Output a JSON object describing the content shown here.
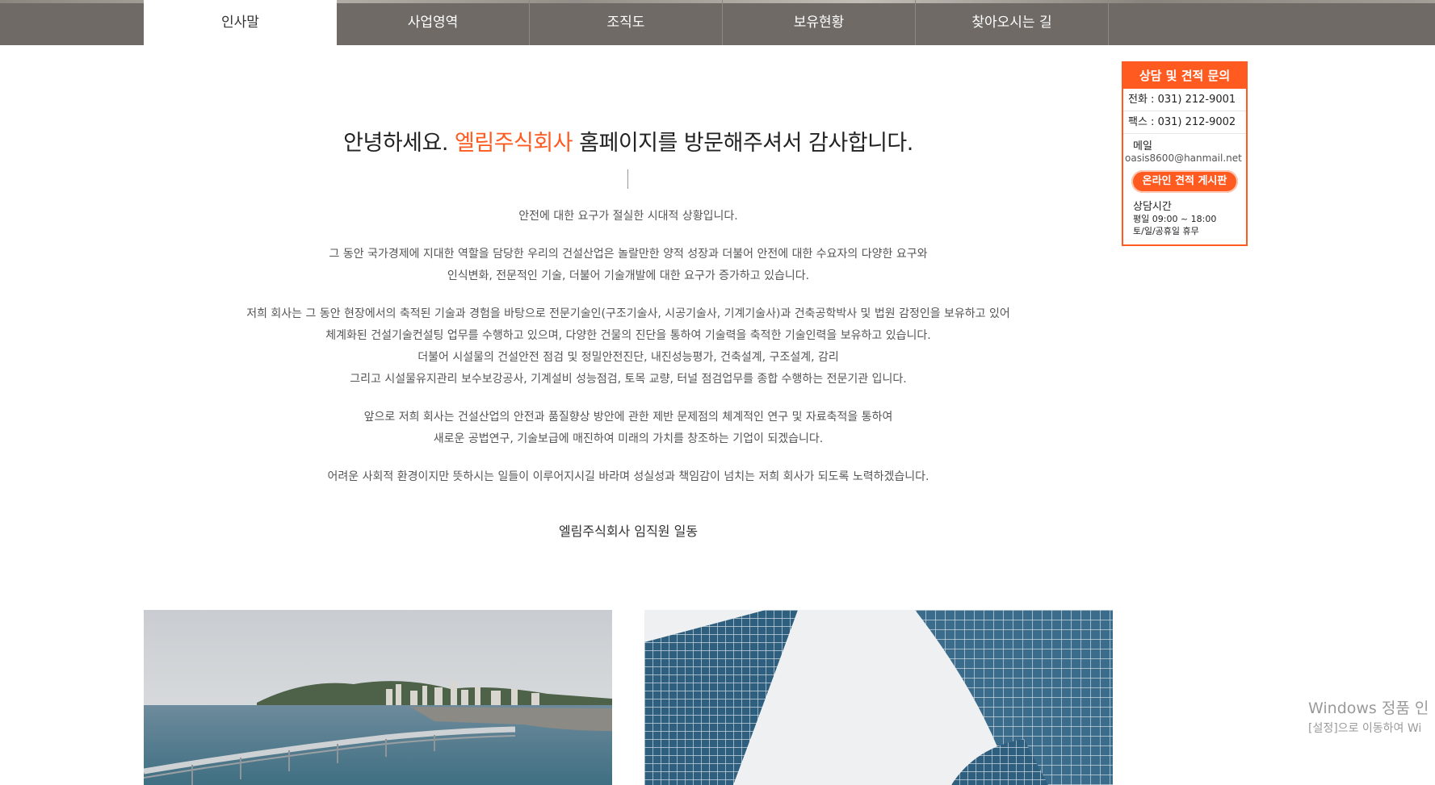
{
  "nav": {
    "tabs": [
      "인사말",
      "사업영역",
      "조직도",
      "보유현황",
      "찾아오시는 길"
    ],
    "active_index": 0
  },
  "greeting": {
    "prefix": "안녕하세요. ",
    "brand": "엘림주식회사",
    "suffix": " 홈페이지를 방문해주셔서 감사합니다."
  },
  "body": {
    "p1": [
      "안전에 대한 요구가 절실한 시대적 상황입니다."
    ],
    "p2": [
      "그 동안 국가경제에 지대한 역할을 담당한 우리의 건설산업은 놀랄만한 양적 성장과 더불어 안전에 대한 수요자의 다양한 요구와",
      "인식변화, 전문적인 기술, 더불어 기술개발에 대한 요구가 증가하고 있습니다."
    ],
    "p3": [
      "저희 회사는 그 동안 현장에서의 축적된 기술과 경험을 바탕으로 전문기술인(구조기술사, 시공기술사, 기계기술사)과 건축공학박사 및 법원 감정인을 보유하고 있어",
      "체계화된 건설기술컨설팅 업무를 수행하고 있으며, 다양한 건물의 진단을 통하여 기술력을 축적한 기술인력을 보유하고 있습니다.",
      "더불어 시설물의 건설안전 점검 및 정밀안전진단, 내진성능평가, 건축설계, 구조설계, 감리",
      "그리고 시설물유지관리 보수보강공사, 기계설비 성능점검, 토목 교량, 터널 점검업무를 종합 수행하는 전문기관 입니다."
    ],
    "p4": [
      "앞으로 저희 회사는 건설산업의 안전과 품질향상 방안에 관한 제반 문제점의 체계적인 연구 및 자료축적을 통하여",
      "새로운 공법연구, 기술보급에 매진하여 미래의 가치를 창조하는 기업이 되겠습니다."
    ],
    "p5": [
      "어려운 사회적 환경이지만 뜻하시는 일들이 이루어지시길 바라며 성실성과 책임감이 넘치는 저희 회사가 되도록 노력하겠습니다."
    ]
  },
  "signature": "엘림주식회사 임직원 일동",
  "consult": {
    "title": "상담 및 견적 문의",
    "phone": "전화 : 031) 212-9001",
    "fax": "팩스 : 031) 212-9002",
    "mail_label": "메일",
    "mail": "oasis8600@hanmail.net",
    "online_button": "온라인 견적 게시판",
    "hours_title": "상담시간",
    "hours_line1": "평일 09:00 ~ 18:00",
    "hours_line2": "토/일/공휴일 휴무"
  },
  "watermark": {
    "line1": "Windows 정품 인",
    "line2": "[설정]으로 이동하여 Wi"
  },
  "colors": {
    "accent": "#ff5a1f",
    "nav_bg": "#6f6a66"
  }
}
